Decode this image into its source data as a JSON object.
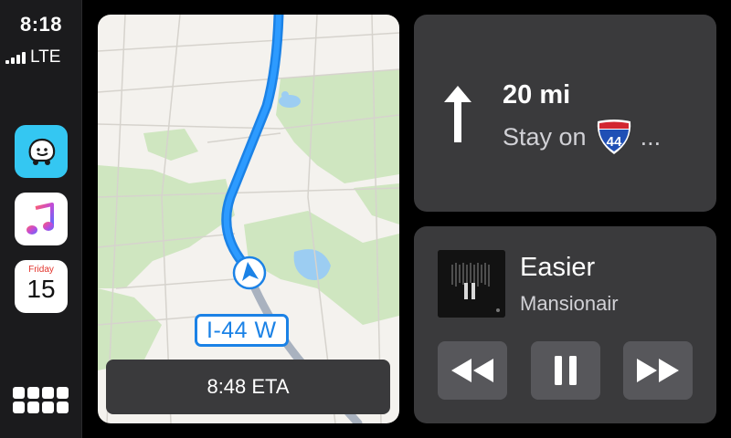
{
  "status": {
    "time": "8:18",
    "network": "LTE"
  },
  "sidebar": {
    "apps": [
      {
        "name": "Waze",
        "icon": "waze-icon"
      },
      {
        "name": "Music",
        "icon": "music-note-icon"
      },
      {
        "name": "Calendar",
        "icon": "calendar-icon",
        "day": "Friday",
        "date": "15"
      }
    ],
    "home_icon": "app-grid-icon"
  },
  "map": {
    "road_label": "I-44 W",
    "eta": "8:48 ETA"
  },
  "navigation": {
    "distance": "20 mi",
    "instruction": "Stay on",
    "shield_number": "44",
    "ellipsis": "..."
  },
  "now_playing": {
    "title": "Easier",
    "artist": "Mansionair",
    "controls": [
      "rewind-icon",
      "pause-icon",
      "fast-forward-icon"
    ]
  },
  "colors": {
    "route_blue": "#1b82e6",
    "park_green": "#cfe6c0",
    "card_bg": "#3a3a3c",
    "waze_blue": "#34c7f2"
  }
}
